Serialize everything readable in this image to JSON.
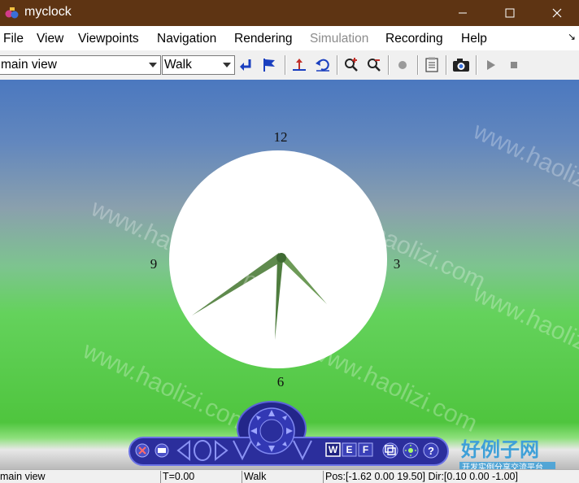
{
  "window": {
    "title": "myclock",
    "buttons": [
      "minimize",
      "maximize",
      "close"
    ]
  },
  "menu": {
    "items": [
      {
        "label": "File",
        "enabled": true
      },
      {
        "label": "View",
        "enabled": true
      },
      {
        "label": "Viewpoints",
        "enabled": true
      },
      {
        "label": "Navigation",
        "enabled": true
      },
      {
        "label": "Rendering",
        "enabled": true
      },
      {
        "label": "Simulation",
        "enabled": false
      },
      {
        "label": "Recording",
        "enabled": true
      },
      {
        "label": "Help",
        "enabled": true
      }
    ]
  },
  "toolbar": {
    "viewpoint_select": "main view",
    "navmode_select": "Walk",
    "icons": [
      "go-back-icon",
      "flag-icon",
      "straighten-icon",
      "undo-move-icon",
      "zoom-in-icon",
      "zoom-out-icon",
      "record-icon",
      "document-icon",
      "camera-icon",
      "play-icon",
      "stop-icon"
    ]
  },
  "scene": {
    "clock_labels": {
      "twelve": "12",
      "three": "3",
      "six": "6",
      "nine": "9"
    },
    "watermark_text": "www.haolizi.com",
    "colors": {
      "sky_top": "#4b78bf",
      "ground": "#5fd15a",
      "hand": "#5f8a4d",
      "dashboard": "#2b2e9c"
    }
  },
  "dashboard": {
    "left_icons": [
      "close-icon",
      "minimize-icon",
      "scroll-icon",
      "compass-icon"
    ],
    "mode_buttons": [
      "W",
      "E",
      "F"
    ],
    "right_icons": [
      "viewport-icon",
      "light-icon",
      "help-icon"
    ]
  },
  "logo": {
    "text": "好例子网",
    "subtext": "开发实例分享交流平台"
  },
  "status": {
    "viewpoint": "main view",
    "time": "T=0.00",
    "mode": "Walk",
    "position": "Pos:[-1.62 0.00 19.50] Dir:[0.10 0.00 -1.00]"
  }
}
